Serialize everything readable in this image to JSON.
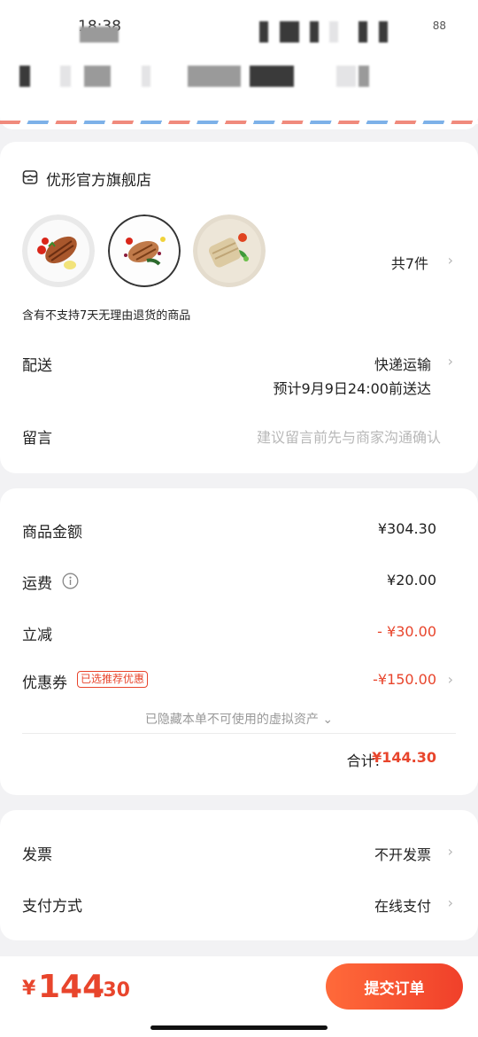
{
  "status": {
    "time": "18:38",
    "battery": "88"
  },
  "shop": {
    "name": "优形官方旗舰店",
    "icon": "shop-icon"
  },
  "products": {
    "count_label": "共7件",
    "dishes": [
      "chicken-breast-tomato",
      "chicken-breast-berries",
      "sliced-chicken-salad"
    ],
    "return_notice": "含有不支持7天无理由退货的商品"
  },
  "delivery": {
    "label": "配送",
    "method": "快递运输",
    "eta": "预计9月9日24:00前送达"
  },
  "message": {
    "label": "留言",
    "placeholder": "建议留言前先与商家沟通确认"
  },
  "costs": {
    "goods_label": "商品金额",
    "goods_value": "¥304.30",
    "shipping_label": "运费",
    "shipping_value": "¥20.00",
    "discount_label": "立减",
    "discount_value": "- ¥30.00",
    "coupon_label": "优惠券",
    "coupon_badge": "已选推荐优惠",
    "coupon_value": "-¥150.00",
    "hidden_assets": "已隐藏本单不可使用的虚拟资产 ⌄",
    "total_label": "合计:",
    "total_value": "¥144.30"
  },
  "invoice": {
    "label": "发票",
    "value": "不开发票"
  },
  "payment": {
    "label": "支付方式",
    "value": "在线支付"
  },
  "footer": {
    "currency": "¥",
    "amount_int": "144",
    "amount_dec": ".30",
    "submit_label": "提交订单"
  },
  "colors": {
    "accent": "#e8452c",
    "background": "#f2f2f4",
    "card": "#ffffff",
    "muted": "#b8b8b8"
  }
}
